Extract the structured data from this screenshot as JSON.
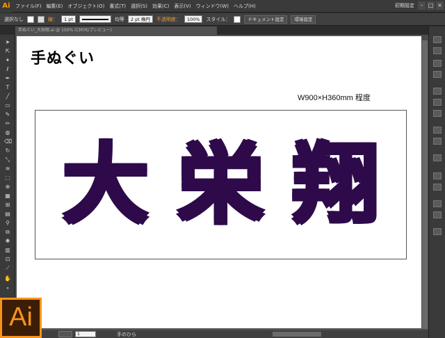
{
  "app": {
    "logo": "Ai",
    "menu": [
      "ファイル(F)",
      "編集(E)",
      "オブジェクト(O)",
      "書式(T)",
      "選択(S)",
      "効果(C)",
      "表示(V)",
      "ウィンドウ(W)",
      "ヘルプ(H)"
    ],
    "workspace": "初期設定",
    "window_buttons": [
      "–",
      "□",
      "×"
    ]
  },
  "control": {
    "selection": "選択なし",
    "stroke_label": "線：",
    "stroke_weight": "1 pt",
    "stroke_profile": "均等",
    "brush": "2 pt 楕円",
    "opacity_label": "不透明度：",
    "opacity_value": "100%",
    "style_label": "スタイル：",
    "doc_settings": "ドキュメント設定",
    "preferences": "環境設定"
  },
  "doc_tab": "手ぬぐい_大栄翔.ai @ 100% (CMYK/プレビュー)",
  "artboard": {
    "title": "手ぬぐい",
    "size_label": "W900×H360mm 程度",
    "name_chars": [
      "大",
      "栄",
      "翔"
    ]
  },
  "status": {
    "page": "1",
    "tool": "手のひら"
  },
  "badge": "Ai",
  "colors": {
    "accent": "#f7941d",
    "name_fill": "#2e0a4a"
  }
}
